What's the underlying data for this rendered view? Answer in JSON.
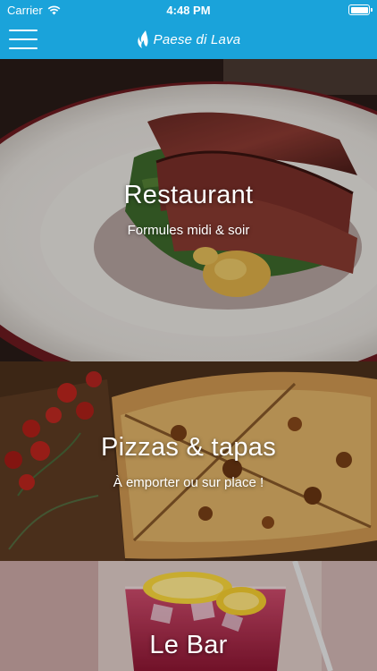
{
  "status_bar": {
    "carrier": "Carrier",
    "time": "4:48 PM",
    "battery_level": 1.0
  },
  "nav": {
    "brand": "Paese di Lava"
  },
  "cards": [
    {
      "title": "Restaurant",
      "subtitle": "Formules midi & soir"
    },
    {
      "title": "Pizzas & tapas",
      "subtitle": "À emporter ou sur place !"
    },
    {
      "title": "Le Bar",
      "subtitle": ""
    }
  ],
  "colors": {
    "accent": "#1aa3da",
    "text": "#ffffff"
  }
}
